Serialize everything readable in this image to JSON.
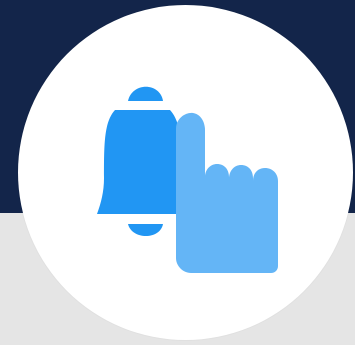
{
  "illustration": {
    "icon": "doorbell-press-icon",
    "parts": {
      "bell": "bell-icon",
      "hand": "pointing-hand-icon"
    }
  },
  "colors": {
    "top_background": "#13254a",
    "bottom_background": "#e5e5e5",
    "badge_background": "#ffffff",
    "bell_primary": "#2196f3",
    "hand_primary": "#64b5f6"
  }
}
